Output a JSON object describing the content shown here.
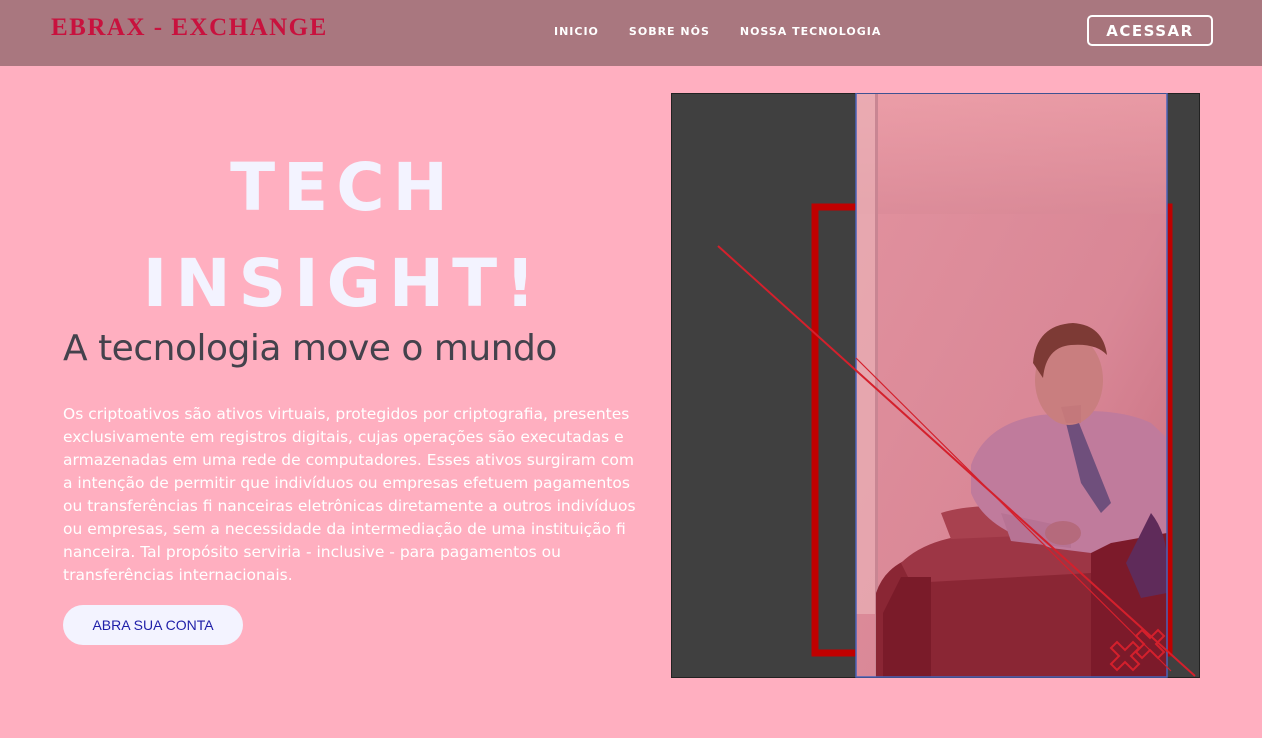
{
  "header": {
    "brand": "EBRAX - EXCHANGE",
    "nav": [
      {
        "label": "INICIO"
      },
      {
        "label": "SOBRE NÓS"
      },
      {
        "label": "NOSSA TECNOLOGIA"
      }
    ],
    "login_label": "ACESSAR"
  },
  "hero": {
    "title_line1": "TECH",
    "title_line2": "INSIGHT!",
    "subtitle": "A tecnologia move o mundo",
    "description": "Os criptoativos são ativos virtuais, protegidos por criptografia, presentes exclusivamente em registros digitais, cujas operações são executadas e armazenadas em uma rede de computadores. Esses ativos surgiram com a intenção de permitir que indivíduos ou empresas efetuem pagamentos ou transferências fi nanceiras eletrônicas diretamente a outros indivíduos ou empresas, sem a necessidade da intermediação de uma instituição fi nanceira. Tal propósito serviria - inclusive - para pagamentos ou transferências internacionais.",
    "cta_label": "ABRA SUA CONTA"
  },
  "colors": {
    "page_background": "#ffafc0",
    "navbar": "#a9777f",
    "brand": "#c8123e",
    "accent_red": "#c00000",
    "image_panel": "#404040",
    "cta_text": "#1f1fa8"
  },
  "icons": {
    "cross_decoration": "double-cross-icon"
  }
}
